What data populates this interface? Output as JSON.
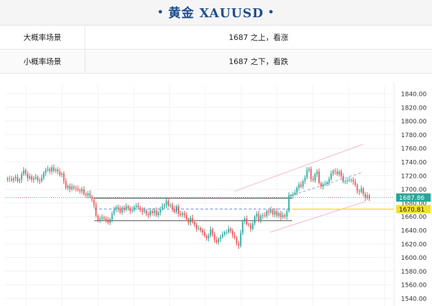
{
  "header": {
    "title": "黄金 XAUUSD",
    "dot": "•"
  },
  "scenarios": [
    {
      "label": "大概率场景",
      "value": "1687 之上，看涨"
    },
    {
      "label": "小概率场景",
      "value": "1687 之下，看跌"
    }
  ],
  "chart_data": {
    "type": "candlestick",
    "title": "",
    "xlabel": "",
    "ylabel": "",
    "ylim": [
      1535,
      1845
    ],
    "y_ticks": [
      1840,
      1820,
      1800,
      1780,
      1760,
      1740,
      1720,
      1700,
      1680,
      1660,
      1640,
      1620,
      1600,
      1580,
      1560,
      1540
    ],
    "y_tick_labels": [
      "1840.00",
      "1820.00",
      "1800.00",
      "1780.00",
      "1760.00",
      "1740.00",
      "1720.00",
      "1700.00",
      "1680.00",
      "1660.00",
      "1640.00",
      "1620.00",
      "1600.00",
      "1580.00",
      "1560.00",
      "1540.00"
    ],
    "grid": true,
    "up_color": "#26a69a",
    "down_color": "#ef5350",
    "closes": [
      1716,
      1715,
      1713,
      1716,
      1718,
      1712,
      1714,
      1722,
      1728,
      1723,
      1716,
      1719,
      1714,
      1716,
      1718,
      1713,
      1712,
      1717,
      1724,
      1728,
      1730,
      1726,
      1732,
      1727,
      1729,
      1726,
      1721,
      1723,
      1712,
      1702,
      1705,
      1700,
      1704,
      1702,
      1701,
      1699,
      1697,
      1700,
      1693,
      1691,
      1694,
      1689,
      1685,
      1677,
      1661,
      1655,
      1657,
      1659,
      1657,
      1655,
      1651,
      1656,
      1664,
      1670,
      1674,
      1671,
      1666,
      1673,
      1670,
      1675,
      1672,
      1668,
      1670,
      1674,
      1676,
      1673,
      1670,
      1667,
      1669,
      1664,
      1662,
      1668,
      1665,
      1669,
      1662,
      1666,
      1671,
      1675,
      1677,
      1683,
      1676,
      1677,
      1671,
      1667,
      1675,
      1664,
      1662,
      1665,
      1662,
      1656,
      1651,
      1658,
      1652,
      1648,
      1642,
      1643,
      1640,
      1637,
      1632,
      1628,
      1632,
      1641,
      1634,
      1626,
      1622,
      1627,
      1630,
      1634,
      1637,
      1637,
      1642,
      1639,
      1633,
      1629,
      1621,
      1617,
      1636,
      1653,
      1657,
      1649,
      1648,
      1642,
      1650,
      1660,
      1664,
      1654,
      1661,
      1662,
      1661,
      1668,
      1666,
      1670,
      1663,
      1668,
      1661,
      1665,
      1659,
      1662,
      1660,
      1668,
      1691,
      1691,
      1693,
      1695,
      1702,
      1707,
      1704,
      1712,
      1717,
      1728,
      1730,
      1715,
      1713,
      1722,
      1726,
      1709,
      1704,
      1707,
      1708,
      1710,
      1715,
      1723,
      1727,
      1726,
      1722,
      1726,
      1719,
      1711,
      1712,
      1713,
      1713,
      1714,
      1711,
      1706,
      1697,
      1696,
      1701,
      1693,
      1687,
      1691,
      1686
    ],
    "current_price": 1687.86,
    "current_price_label": "1687.86",
    "level_price": 1670.81,
    "level_price_label": "1670.81"
  }
}
